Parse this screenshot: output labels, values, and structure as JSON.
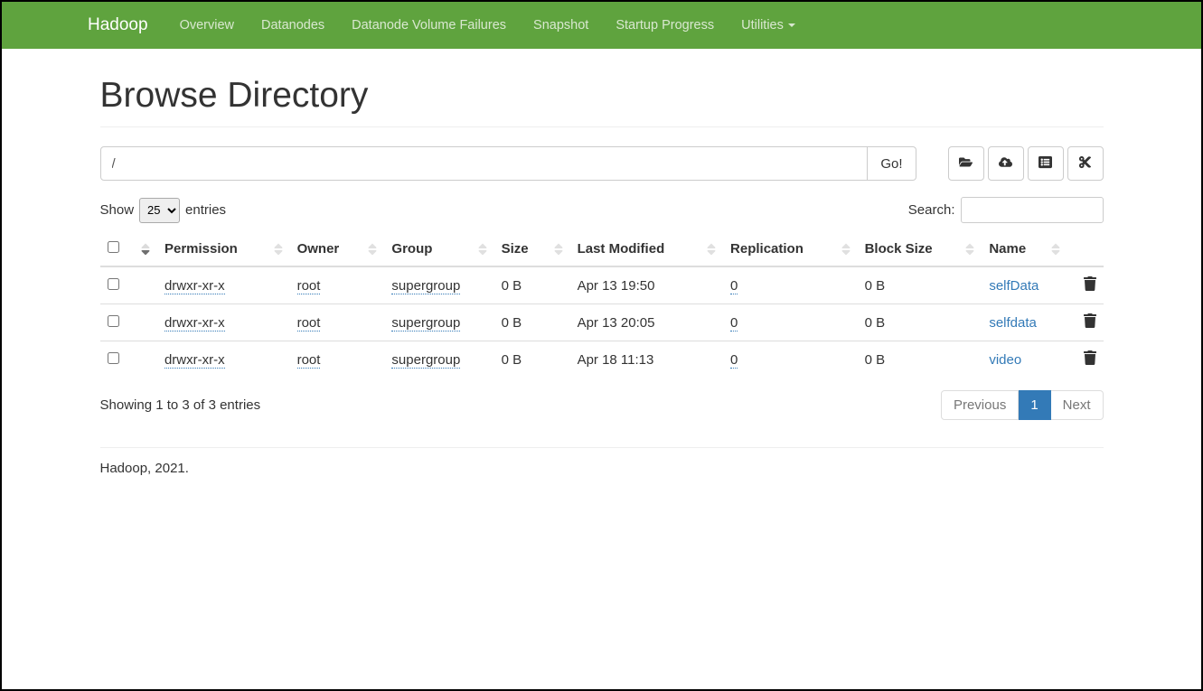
{
  "navbar": {
    "brand": "Hadoop",
    "items": [
      "Overview",
      "Datanodes",
      "Datanode Volume Failures",
      "Snapshot",
      "Startup Progress",
      "Utilities"
    ]
  },
  "page": {
    "title": "Browse Directory",
    "path": "/",
    "go": "Go!"
  },
  "controls": {
    "show": "Show",
    "entries": "entries",
    "page_size": "25",
    "search_label": "Search:"
  },
  "columns": [
    "Permission",
    "Owner",
    "Group",
    "Size",
    "Last Modified",
    "Replication",
    "Block Size",
    "Name"
  ],
  "rows": [
    {
      "permission": "drwxr-xr-x",
      "owner": "root",
      "group": "supergroup",
      "size": "0 B",
      "modified": "Apr 13 19:50",
      "replication": "0",
      "block_size": "0 B",
      "name": "selfData"
    },
    {
      "permission": "drwxr-xr-x",
      "owner": "root",
      "group": "supergroup",
      "size": "0 B",
      "modified": "Apr 13 20:05",
      "replication": "0",
      "block_size": "0 B",
      "name": "selfdata"
    },
    {
      "permission": "drwxr-xr-x",
      "owner": "root",
      "group": "supergroup",
      "size": "0 B",
      "modified": "Apr 18 11:13",
      "replication": "0",
      "block_size": "0 B",
      "name": "video"
    }
  ],
  "footer": {
    "showing": "Showing 1 to 3 of 3 entries",
    "previous": "Previous",
    "page": "1",
    "next": "Next"
  },
  "copyright": "Hadoop, 2021."
}
